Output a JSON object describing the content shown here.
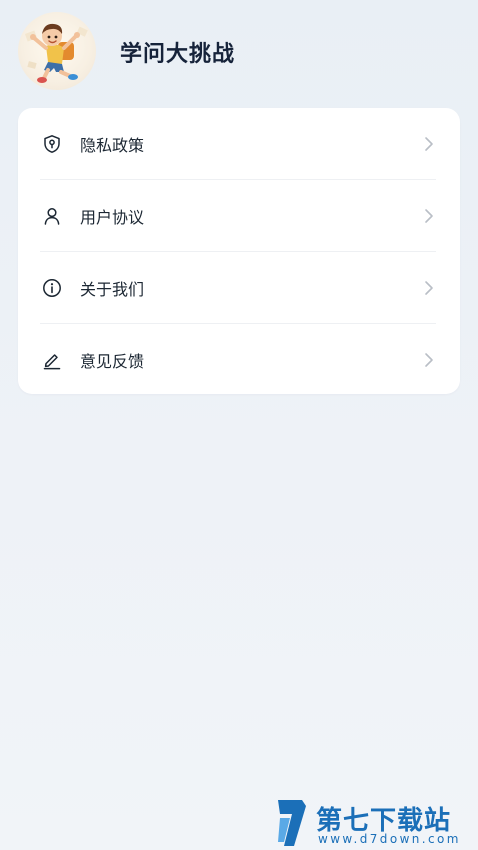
{
  "header": {
    "title": "学问大挑战"
  },
  "menu": {
    "items": [
      {
        "label": "隐私政策",
        "icon": "privacy-shield-icon"
      },
      {
        "label": "用户协议",
        "icon": "user-icon"
      },
      {
        "label": "关于我们",
        "icon": "info-icon"
      },
      {
        "label": "意见反馈",
        "icon": "edit-pen-icon"
      }
    ]
  },
  "watermark": {
    "name": "第七下载站",
    "url": "www.d7down.com"
  },
  "colors": {
    "background": "#eef2f7",
    "card": "#ffffff",
    "text": "#1c2733",
    "chevron": "#b9bec6",
    "watermark": "#1b6fb8"
  }
}
